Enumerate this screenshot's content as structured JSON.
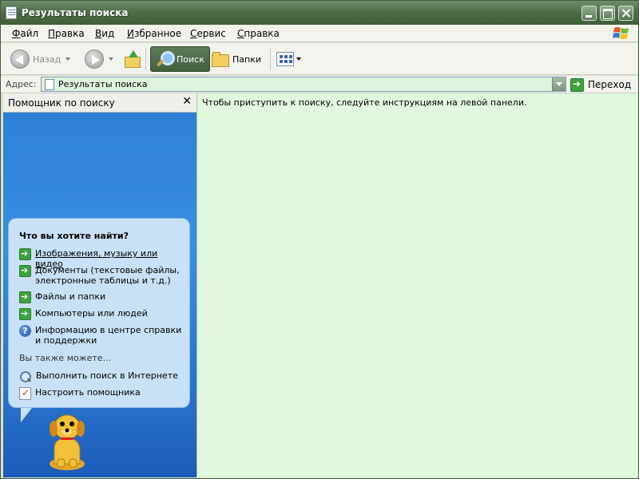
{
  "window": {
    "title": "Результаты поиска"
  },
  "menu": [
    "Файл",
    "Правка",
    "Вид",
    "Избранное",
    "Сервис",
    "Справка"
  ],
  "toolbar": {
    "back": "Назад",
    "search": "Поиск",
    "folders": "Папки"
  },
  "address": {
    "label": "Адрес:",
    "value": "Результаты поиска",
    "go": "Переход"
  },
  "search_pane": {
    "title": "Помощник по поиску",
    "question": "Что вы хотите найти?",
    "options": [
      "Изображения, музыку или видео",
      "Документы (текстовые файлы, электронные таблицы и т.д.)",
      "Файлы и папки",
      "Компьютеры или людей",
      "Информацию в центре справки и поддержки"
    ],
    "also_label": "Вы также можете...",
    "extra": [
      "Выполнить поиск в Интернете",
      "Настроить помощника"
    ]
  },
  "content": {
    "message": "Чтобы приступить к поиску, следуйте инструкциям на левой панели."
  },
  "colors": {
    "titlebar": "#4e6e48",
    "pane": "#2b7ed4",
    "content_bg": "#e0f8dc",
    "bubble": "#c8e1f7"
  }
}
